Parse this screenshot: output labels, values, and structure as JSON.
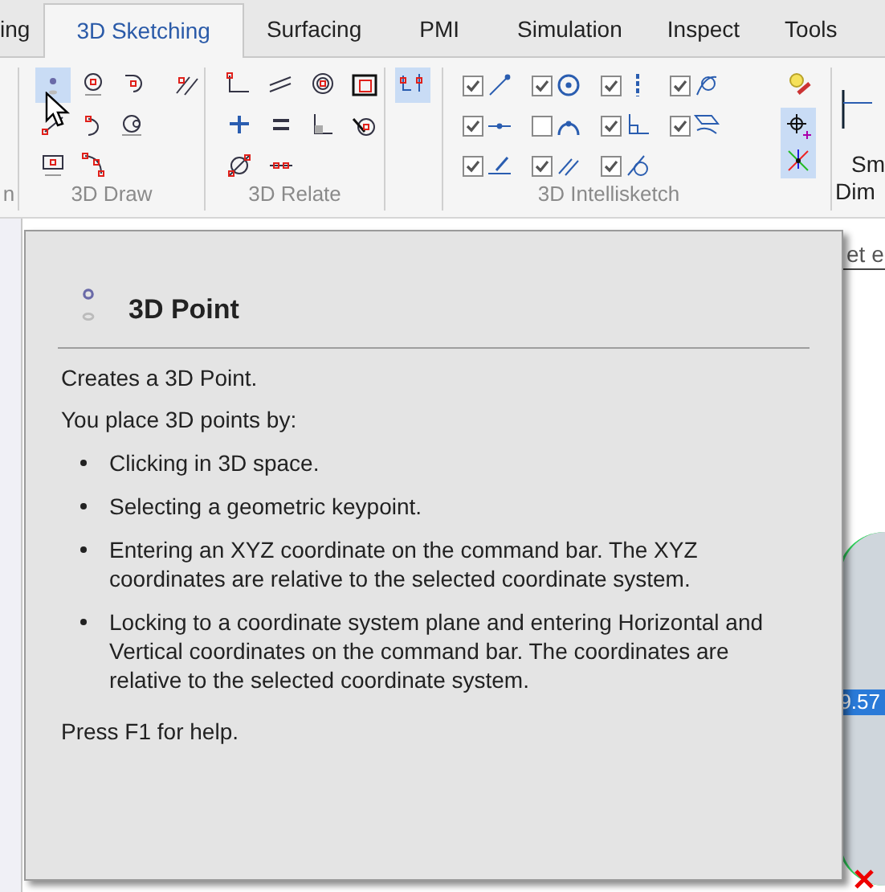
{
  "tabs": [
    {
      "label": "ing",
      "selected": false
    },
    {
      "label": "3D Sketching",
      "selected": true
    },
    {
      "label": "Surfacing",
      "selected": false
    },
    {
      "label": "PMI",
      "selected": false
    },
    {
      "label": "Simulation",
      "selected": false
    },
    {
      "label": "Inspect",
      "selected": false
    },
    {
      "label": "Tools",
      "selected": false
    }
  ],
  "ribbon": {
    "left_group_label": "n",
    "draw_group": {
      "label": "3D Draw"
    },
    "relate_group": {
      "label": "3D Relate"
    },
    "intellisketch_group": {
      "label": "3D Intellisketch",
      "options": [
        {
          "checked": true
        },
        {
          "checked": true
        },
        {
          "checked": true
        },
        {
          "checked": true
        },
        {
          "checked": false
        },
        {
          "checked": true
        },
        {
          "checked": true
        },
        {
          "checked": true
        },
        {
          "checked": true
        },
        {
          "checked": true
        },
        {
          "checked": true
        }
      ]
    },
    "cut_button": {
      "line_1": "Sm",
      "line_2": "Dim"
    }
  },
  "viewport": {
    "field_text": "et e",
    "dimension_value": "9.57"
  },
  "tooltip": {
    "title": "3D Point",
    "intro": "Creates a 3D Point.",
    "lead": "You place 3D points by:",
    "bullets": [
      "Clicking in 3D space.",
      "Selecting a geometric keypoint.",
      "Entering an XYZ coordinate on the command bar. The XYZ coordinates are relative to the selected coordinate system.",
      "Locking to a coordinate system plane and entering Horizontal and Vertical coordinates on the command bar. The coordinates are relative to the selected coordinate system."
    ],
    "footer": "Press F1 for help."
  }
}
